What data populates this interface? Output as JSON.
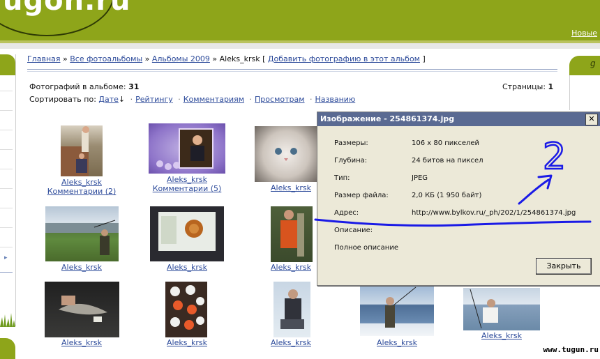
{
  "header": {
    "logo_text": "ugon.ru",
    "right_link": "Новые"
  },
  "breadcrumb": {
    "home": "Главная",
    "albums": "Все фотоальбомы",
    "year": "Альбомы 2009",
    "current": "Aleks_krsk",
    "open_bracket": " [ ",
    "add_photo": "Добавить фотографию в этот альбом",
    "close_bracket": " ]"
  },
  "album_info": {
    "photo_count_label": "Фотографий в альбоме:",
    "photo_count": "31",
    "pages_label": "Страницы:",
    "pages_value": "1"
  },
  "sort": {
    "label": "Сортировать по:",
    "options": [
      "Дате",
      "Рейтингу",
      "Комментариям",
      "Просмотрам",
      "Названию"
    ],
    "arrow": "↓"
  },
  "photos": [
    {
      "author": "Aleks_krsk",
      "comments": "Комментарии (2)"
    },
    {
      "author": "Aleks_krsk",
      "comments": "Комментарии (5)"
    },
    {
      "author": "Aleks_krsk"
    },
    {
      "author": "Aleks_krsk"
    },
    {
      "author": "Aleks_krsk"
    },
    {
      "author": "Aleks_krsk"
    },
    {
      "author": "Aleks_krsk"
    },
    {
      "author": "Aleks_krsk"
    },
    {
      "author": "Aleks_krsk"
    },
    {
      "author": "Aleks_krsk"
    },
    {
      "author": "Aleks_krsk"
    }
  ],
  "dialog": {
    "title": "Изображение - 254861374.jpg",
    "close_x": "✕",
    "rows": [
      {
        "label": "Размеры:",
        "value": "106 x 80 пикселей"
      },
      {
        "label": "Глубина:",
        "value": "24 битов на пиксел"
      },
      {
        "label": "Тип:",
        "value": "JPEG"
      },
      {
        "label": "Размер файла:",
        "value": "2,0 КБ (1 950 байт)"
      },
      {
        "label": "Адрес:",
        "value": "http://www.bylkov.ru/_ph/202/1/254861374.jpg"
      },
      {
        "label": "Описание:",
        "value": ""
      },
      {
        "label": "Полное описание",
        "value": ""
      }
    ],
    "close_button": "Закрыть"
  },
  "annotation": {
    "number": "2",
    "color": "#1a1ae6"
  },
  "watermark": "www.tugun.ru",
  "colors": {
    "header_green": "#8ea51a",
    "link_blue": "#2c4a9a",
    "dialog_title": "#5a6a92"
  }
}
